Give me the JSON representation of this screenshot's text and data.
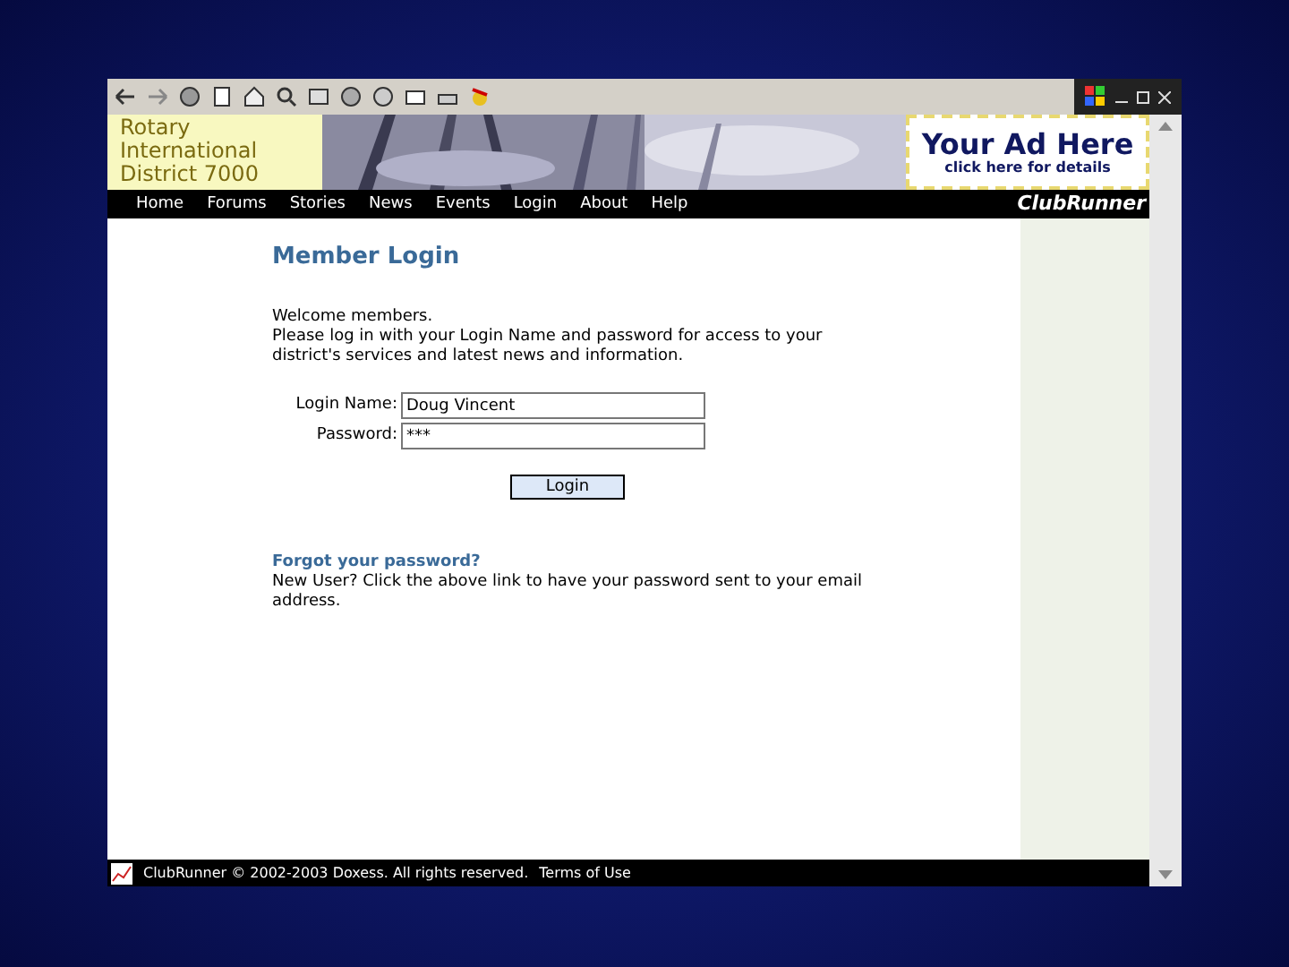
{
  "header": {
    "title_lines": [
      "Rotary",
      "International",
      "District 7000"
    ],
    "ad": {
      "headline": "Your Ad Here",
      "subline": "click here for details"
    }
  },
  "nav": {
    "items": [
      "Home",
      "Forums",
      "Stories",
      "News",
      "Events",
      "Login",
      "About",
      "Help"
    ],
    "brand": "ClubRunner"
  },
  "login": {
    "heading": "Member Login",
    "welcome": "Welcome members.",
    "intro": "Please log in with your Login Name and password for access to your district's services and latest news and information.",
    "fields": [
      {
        "label": "Login Name:",
        "value": "Doug Vincent"
      },
      {
        "label": "Password:",
        "value": "***"
      }
    ],
    "button": "Login",
    "forgot_link": "Forgot your password?",
    "note": "New User? Click the above link to have your password sent to your email address."
  },
  "footer": {
    "text": "ClubRunner © 2002-2003 Doxess. All rights reserved.",
    "link": "Terms of Use"
  }
}
